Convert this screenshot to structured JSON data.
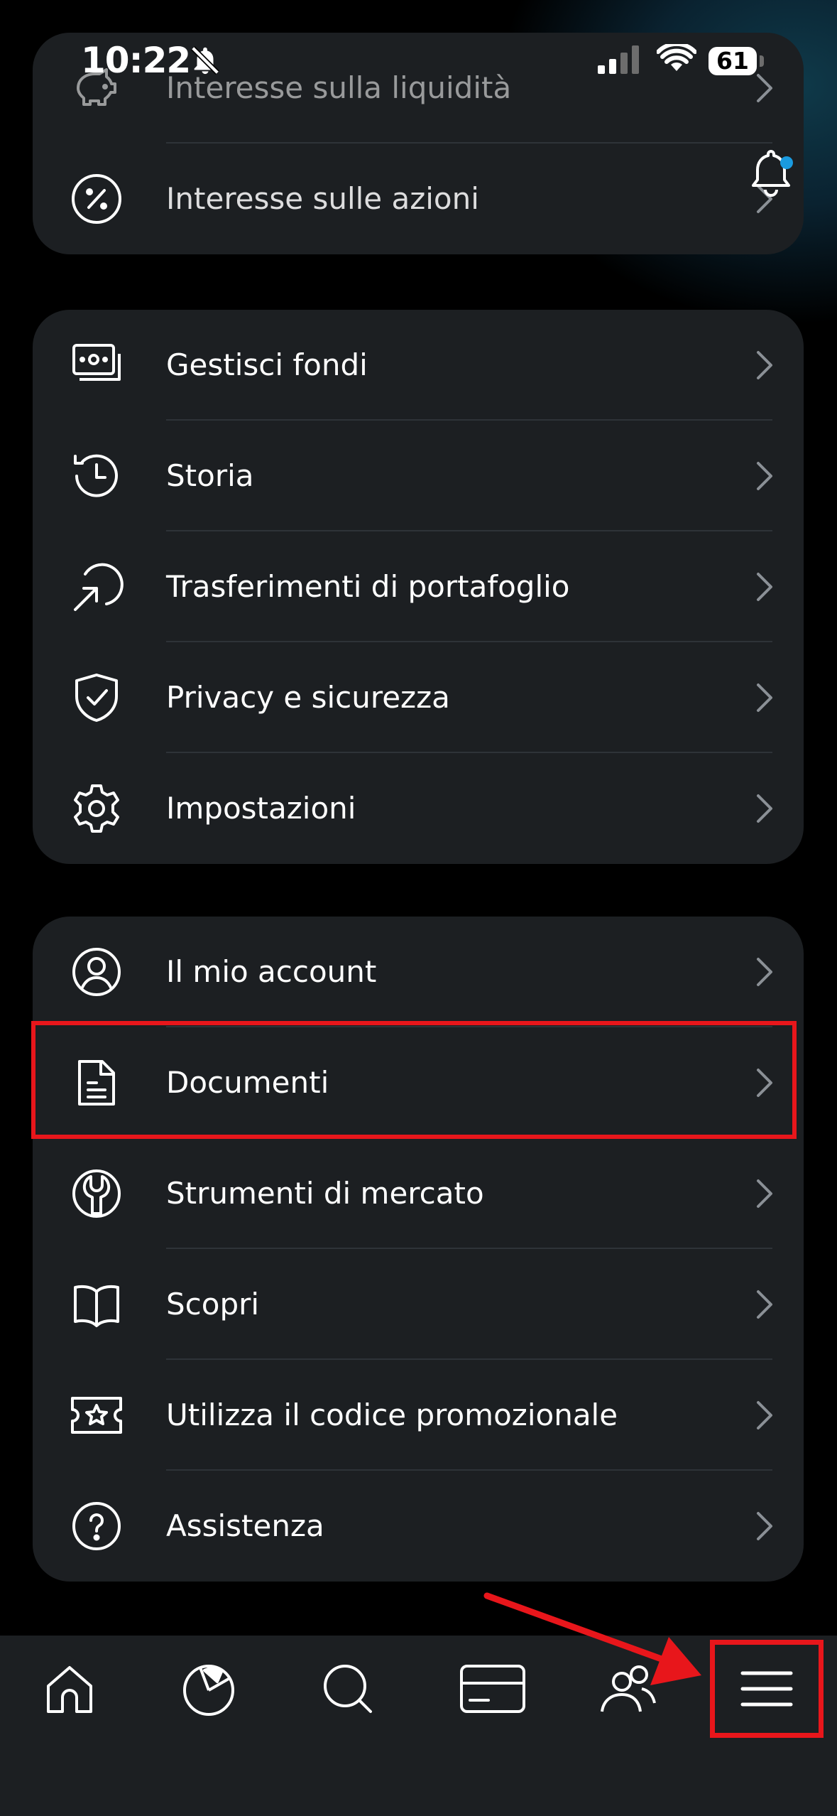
{
  "status_bar": {
    "time": "10:22",
    "battery": "61"
  },
  "menu_groups": [
    {
      "items": [
        {
          "label": "Interesse sulla liquidità",
          "icon": "piggy-bank-icon"
        },
        {
          "label": "Interesse sulle azioni",
          "icon": "percent-icon"
        }
      ]
    },
    {
      "items": [
        {
          "label": "Gestisci fondi",
          "icon": "banknote-icon"
        },
        {
          "label": "Storia",
          "icon": "history-clock-icon"
        },
        {
          "label": "Trasferimenti di portafoglio",
          "icon": "transfer-arrow-icon"
        },
        {
          "label": "Privacy e sicurezza",
          "icon": "shield-check-icon"
        },
        {
          "label": "Impostazioni",
          "icon": "gear-icon"
        }
      ]
    },
    {
      "items": [
        {
          "label": "Il mio account",
          "icon": "user-circle-icon"
        },
        {
          "label": "Documenti",
          "icon": "document-icon"
        },
        {
          "label": "Strumenti di mercato",
          "icon": "wrench-icon"
        },
        {
          "label": "Scopri",
          "icon": "book-icon"
        },
        {
          "label": "Utilizza il codice promozionale",
          "icon": "ticket-star-icon"
        },
        {
          "label": "Assistenza",
          "icon": "help-circle-icon"
        }
      ]
    }
  ],
  "tab_bar": {
    "tabs": [
      {
        "name": "home",
        "icon": "home-icon"
      },
      {
        "name": "portfolio",
        "icon": "pie-chart-icon"
      },
      {
        "name": "search",
        "icon": "search-icon"
      },
      {
        "name": "card",
        "icon": "credit-card-icon"
      },
      {
        "name": "community",
        "icon": "users-icon"
      },
      {
        "name": "menu",
        "icon": "hamburger-menu-icon"
      }
    ]
  },
  "colors": {
    "background": "#000000",
    "card": "#1c1f22",
    "highlight": "#e8161b",
    "notification_dot": "#1a9be0"
  }
}
